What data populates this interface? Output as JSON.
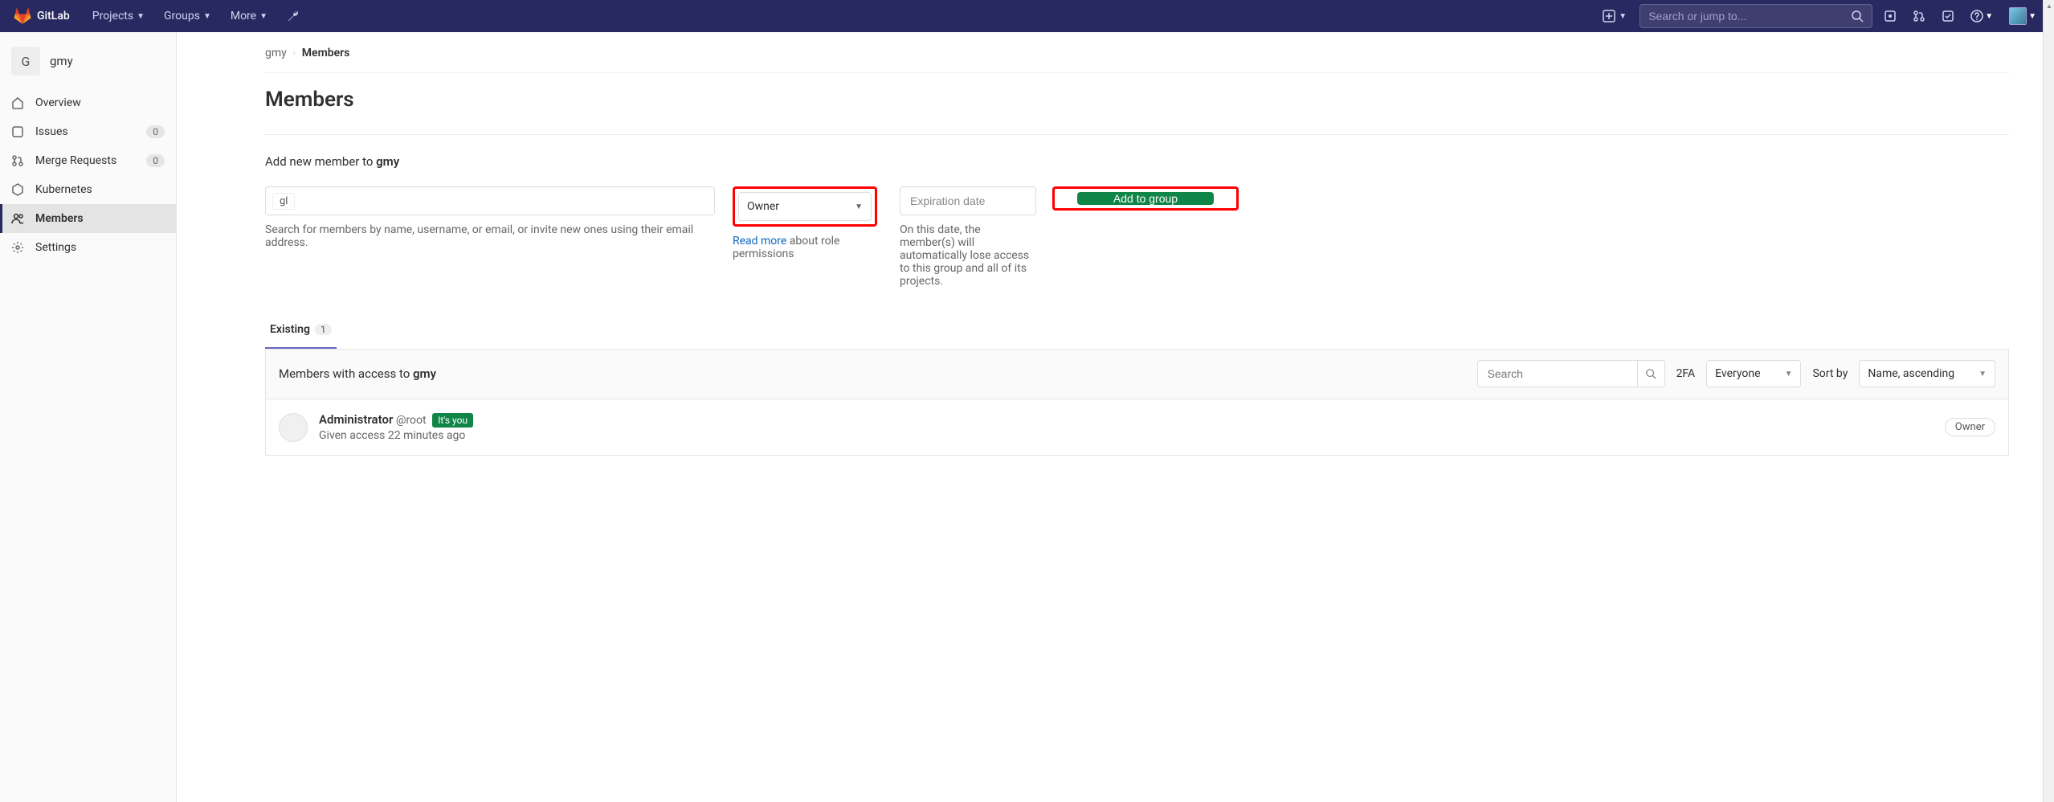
{
  "topnav": {
    "brand": "GitLab",
    "items": [
      "Projects",
      "Groups",
      "More"
    ],
    "search_placeholder": "Search or jump to..."
  },
  "sidebar": {
    "group_initial": "G",
    "group_name": "gmy",
    "items": [
      {
        "label": "Overview",
        "badge": null
      },
      {
        "label": "Issues",
        "badge": "0"
      },
      {
        "label": "Merge Requests",
        "badge": "0"
      },
      {
        "label": "Kubernetes",
        "badge": null
      },
      {
        "label": "Members",
        "badge": null
      },
      {
        "label": "Settings",
        "badge": null
      }
    ]
  },
  "breadcrumb": {
    "root": "gmy",
    "current": "Members"
  },
  "page": {
    "title": "Members",
    "add_prefix": "Add new member to ",
    "add_group": "gmy",
    "search_token": "gl",
    "search_help": "Search for members by name, username, or email, or invite new ones using their email address.",
    "role_selected": "Owner",
    "role_help_link": "Read more",
    "role_help_text": " about role permissions",
    "expire_placeholder": "Expiration date",
    "expire_help": "On this date, the member(s) will automatically lose access to this group and all of its projects.",
    "add_button": "Add to group"
  },
  "tabs": {
    "existing_label": "Existing",
    "existing_count": "1"
  },
  "filter": {
    "title_prefix": "Members with access to ",
    "title_group": "gmy",
    "search_placeholder": "Search",
    "f2fa_label": "2FA",
    "f2fa_value": "Everyone",
    "sort_label": "Sort by",
    "sort_value": "Name, ascending"
  },
  "member": {
    "name": "Administrator",
    "username": "@root",
    "you_badge": "It's you",
    "access": "Given access 22 minutes ago",
    "role": "Owner"
  }
}
